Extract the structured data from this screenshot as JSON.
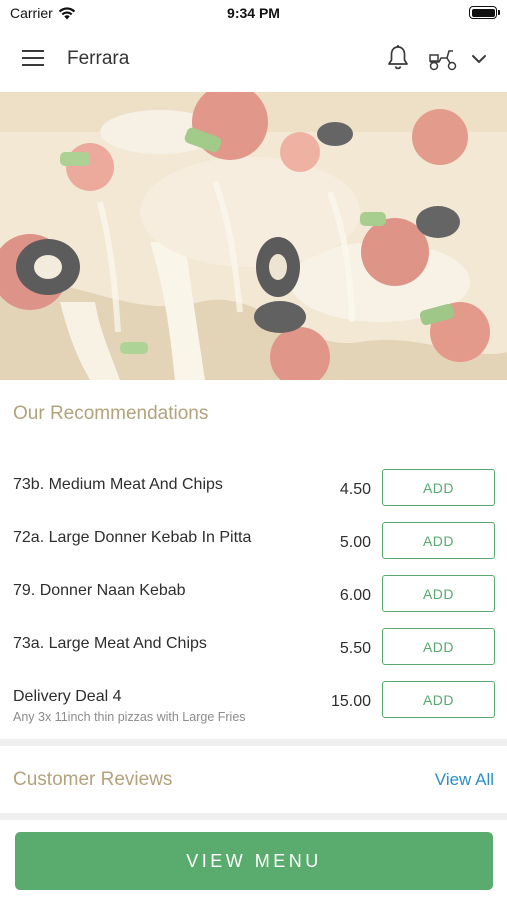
{
  "status_bar": {
    "carrier": "Carrier",
    "time": "9:34 PM"
  },
  "header": {
    "title": "Ferrara",
    "icons": [
      "menu-icon",
      "bell-icon",
      "scooter-icon",
      "chevron-down-icon"
    ]
  },
  "hero": {
    "image": "pizza-closeup-image"
  },
  "recommendations": {
    "title": "Our Recommendations",
    "items": [
      {
        "name": "73b. Medium Meat And Chips",
        "description": "",
        "price": "4.50",
        "button": "ADD"
      },
      {
        "name": "72a. Large Donner Kebab In Pitta",
        "description": "",
        "price": "5.00",
        "button": "ADD"
      },
      {
        "name": "79. Donner Naan Kebab",
        "description": "",
        "price": "6.00",
        "button": "ADD"
      },
      {
        "name": "73a. Large Meat And Chips",
        "description": "",
        "price": "5.50",
        "button": "ADD"
      },
      {
        "name": "Delivery Deal 4",
        "description": "Any 3x 11inch thin pizzas with Large Fries",
        "price": "15.00",
        "button": "ADD"
      }
    ]
  },
  "reviews": {
    "title": "Customer Reviews",
    "view_all": "View All"
  },
  "footer": {
    "view_menu": "VIEW MENU"
  },
  "colors": {
    "accent_green": "#5aac6e",
    "section_title": "#b3a27c",
    "link_blue": "#2a8fc7"
  }
}
